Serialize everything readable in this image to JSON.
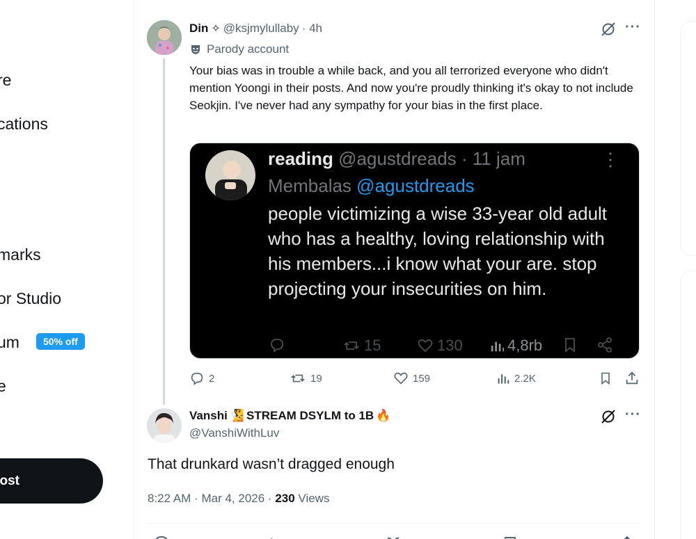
{
  "sidebar": {
    "items": [
      {
        "label": "re"
      },
      {
        "label": "cations"
      },
      {
        "label": "marks"
      },
      {
        "label": "or Studio"
      },
      {
        "label": "um"
      },
      {
        "label": "e"
      }
    ],
    "promo_badge": "50% off",
    "post_button": "ost"
  },
  "post": {
    "author_name": "Din",
    "author_badge": "✧",
    "handle": "@ksjmylullaby",
    "time": "· 4h",
    "label": "Parody account",
    "text": "Your bias was in trouble a while back, and you all terrorized everyone who didn't mention Yoongi in their posts. And now you're proudly thinking it's okay to not include Seokjin. I've never had any sympathy for your bias in the first place.",
    "embed": {
      "name": "reading",
      "handle": "@agustdreads · 11 jam",
      "reply_prefix": "Membalas",
      "reply_handle": "@agustdreads",
      "text": "people victimizing a wise 33-year old adult who has a healthy, loving relationship with his members...i know what your are. stop projecting your insecurities on him.",
      "reposts": "15",
      "likes": "130",
      "views": "4,8rb"
    },
    "stats": {
      "replies": "2",
      "reposts": "19",
      "likes": "159",
      "views": "2.2K"
    }
  },
  "reply": {
    "author_name": "Vanshi",
    "author_emoji_1": "🧏",
    "author_name_suffix": "STREAM DSYLM to 1B",
    "author_emoji_2": "🔥",
    "handle": "@VanshiWithLuv",
    "text": "That drunkard wasn’t dragged enough",
    "time": "8:22 AM · Mar 4, 2026 · ",
    "views_count": "230",
    "views_label": " Views"
  },
  "colors": {
    "accent": "#1d9bf0",
    "muted": "#536471",
    "text": "#0f1419"
  }
}
